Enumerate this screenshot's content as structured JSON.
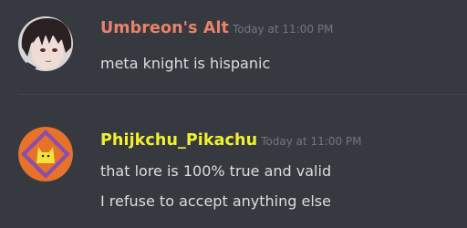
{
  "messages": [
    {
      "username": "Umbreon's Alt",
      "username_color": "#e9826b",
      "timestamp": "Today at 11:00 PM",
      "lines": [
        "meta knight is hispanic"
      ],
      "avatar_icon": "anime-character-avatar"
    },
    {
      "username": "Phijkchu_Pikachu",
      "username_color": "#f1f12f",
      "timestamp": "Today at 11:00 PM",
      "lines": [
        "that lore is 100% true and valid",
        "I refuse to accept anything else"
      ],
      "avatar_icon": "pikachu-diamond-avatar"
    }
  ]
}
